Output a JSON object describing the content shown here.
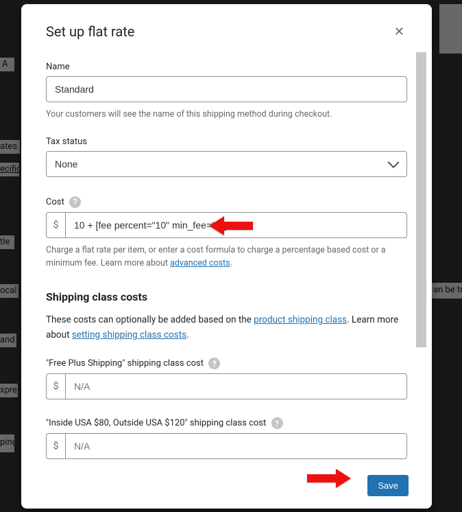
{
  "bg": {
    "cell_a": "A",
    "rates": "ates",
    "specific": "ecific",
    "title": "tle",
    "local": "ocal",
    "can_be_tri": "an be tri",
    "and": "and",
    "express": "xpre",
    "btn": "ping"
  },
  "modal": {
    "title": "Set up flat rate",
    "close": "✕",
    "name_label": "Name",
    "name_value": "Standard",
    "name_hint": "Your customers will see the name of this shipping method during checkout.",
    "tax_label": "Tax status",
    "tax_value": "None",
    "cost_label": "Cost",
    "currency": "$",
    "cost_value": "10 + [fee percent=\"10\" min_fee=\"4\"]",
    "cost_hint_before": "Charge a flat rate per item, or enter a cost formula to charge a percentage based cost or a minimum fee. Learn more about ",
    "cost_hint_link": "advanced costs",
    "cost_hint_after": ".",
    "shipping_heading": "Shipping class costs",
    "shipping_desc_1": "These costs can optionally be added based on the ",
    "shipping_desc_link1": "product shipping class",
    "shipping_desc_2": ". Learn more about ",
    "shipping_desc_link2": "setting shipping class costs",
    "shipping_desc_3": ".",
    "class1_label": "\"Free Plus Shipping\" shipping class cost",
    "class1_placeholder": "N/A",
    "class2_label": "\"Inside USA $80, Outside USA $120\" shipping class cost",
    "class2_placeholder": "N/A",
    "help_glyph": "?"
  },
  "footer": {
    "save": "Save"
  }
}
